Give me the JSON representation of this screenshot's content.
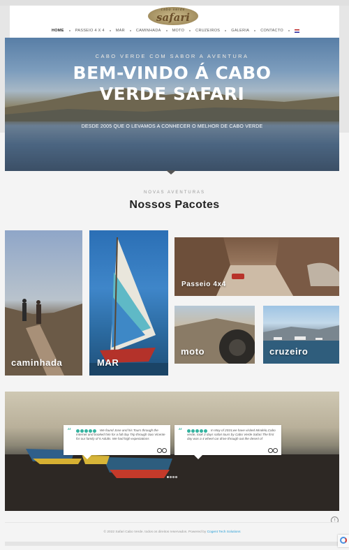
{
  "logo": {
    "small": "cabo verde",
    "main": "safari"
  },
  "nav": {
    "items": [
      "HOME",
      "PASSEIO 4 X 4",
      "MAR",
      "CAMINHADA",
      "MOTO",
      "CRUZEIROS",
      "GALERIA",
      "CONTACTO"
    ],
    "active": "HOME"
  },
  "hero": {
    "subtitle": "CABO VERDE COM SABOR A AVENTURA",
    "title_line1": "BEM-VINDO Á CABO",
    "title_line2": "VERDE SAFARI",
    "tagline": "DESDE 2005 QUE O LEVAMOS A CONHECER O MELHOR DE CABO VERDE"
  },
  "packages": {
    "subtitle": "NOVAS AVENTURAS",
    "title": "Nossos Pacotes",
    "tiles": {
      "caminhada": "caminhada",
      "mar": "MAR",
      "passeio": "Passeio 4x4",
      "moto": "moto",
      "cruzeiro": "cruzeiro"
    }
  },
  "testimonials": [
    {
      "text": "We found Jose and his Tours through the Internet and booked him for a full day Trip through Sao Vicente for our family of 5 Adults. We had high expectations",
      "rating": 5
    },
    {
      "text": "In May of 2015,we have visited Mindelo,Cabo verde, took 3 days safari tours by Cabo Verde Safari.The first day was a 4 wheel car drive through out the desert of",
      "rating": 5
    }
  ],
  "footer": {
    "copyright": "© 2022 Safari Cabo Verde. todos os direitos reservados. Powered by",
    "powered_by": "Cogent Tech Solutions"
  },
  "colors": {
    "accent": "#34b3a0",
    "link": "#2a9fd6"
  }
}
